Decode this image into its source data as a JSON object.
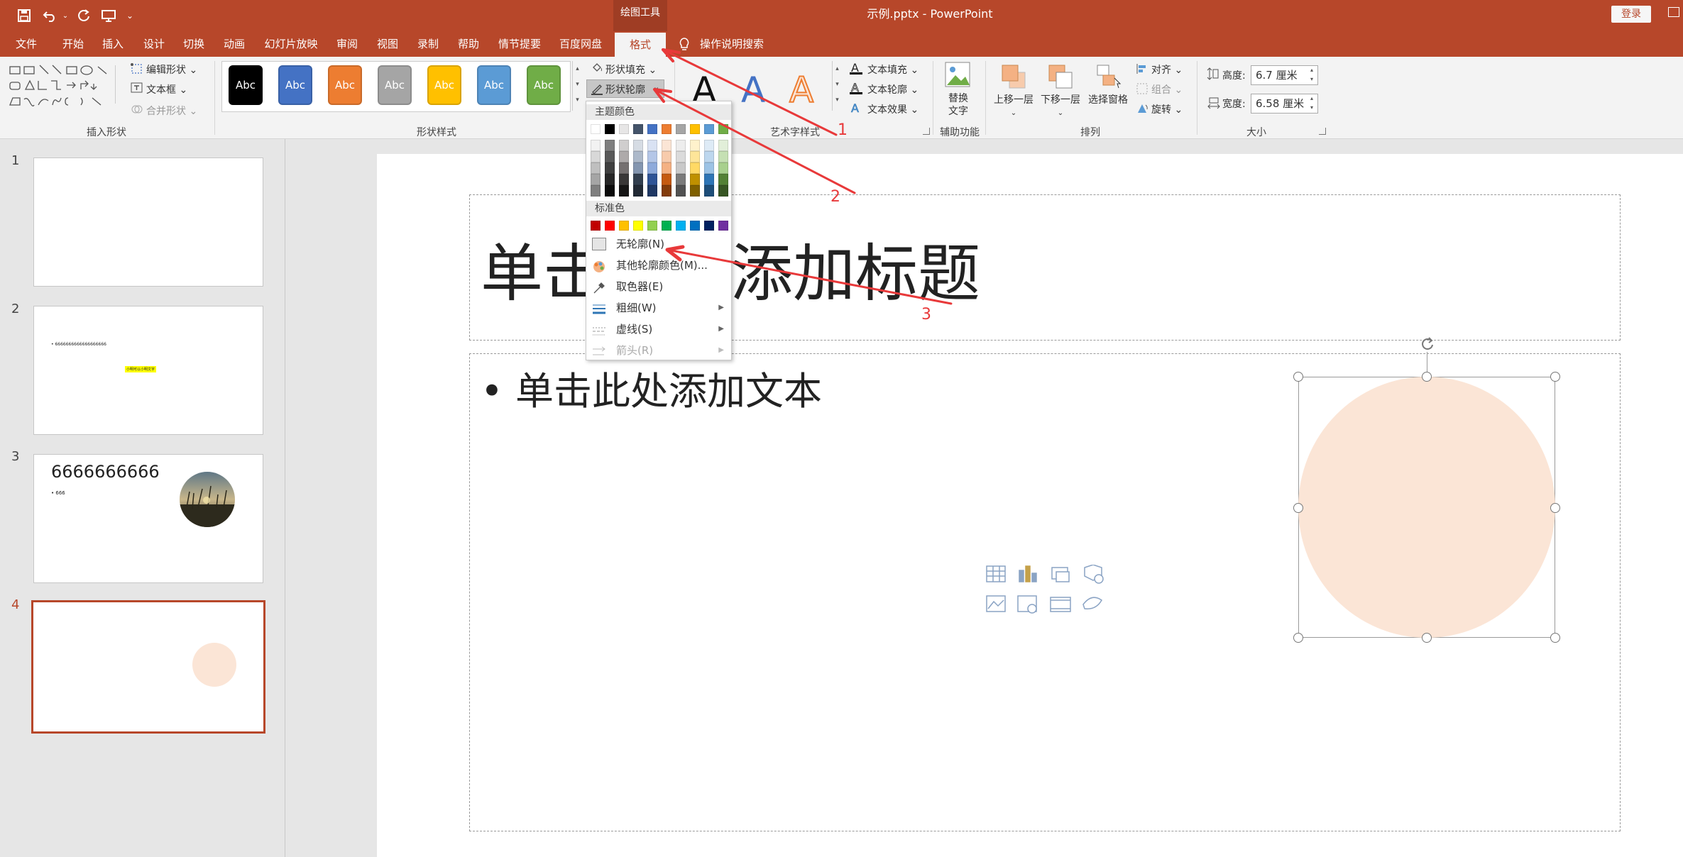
{
  "window": {
    "title": "示例.pptx - PowerPoint",
    "drawing_tools_label": "绘图工具",
    "login_label": "登录",
    "accent_color": "#b7472a"
  },
  "quick_access": {
    "icons": [
      "save-icon",
      "undo-icon",
      "redo-icon",
      "start-slideshow-icon",
      "customize-qat-icon"
    ]
  },
  "ribbon_tabs": {
    "file": "文件",
    "home": "开始",
    "insert": "插入",
    "design": "设计",
    "transitions": "切换",
    "animations": "动画",
    "slideshow": "幻灯片放映",
    "review": "审阅",
    "view": "视图",
    "record": "录制",
    "help": "帮助",
    "storyboard": "情节提要",
    "baidu": "百度网盘",
    "format": "格式",
    "tell_me": "操作说明搜索"
  },
  "ribbon": {
    "insert_shapes": {
      "group_label": "插入形状",
      "edit_shape": "编辑形状",
      "text_box": "文本框",
      "merge_shapes": "合并形状"
    },
    "shape_styles": {
      "group_label": "形状样式",
      "preset_label": "Abc",
      "preset_colors": [
        "#000000",
        "#4472c4",
        "#ed7d31",
        "#a5a5a5",
        "#ffc000",
        "#5b9bd5",
        "#70ad47"
      ],
      "shape_fill": "形状填充",
      "shape_outline": "形状轮廓"
    },
    "wordart": {
      "group_label": "艺术字样式",
      "letter": "A",
      "text_fill": "文本填充",
      "text_outline": "文本轮廓",
      "text_effects": "文本效果"
    },
    "accessibility": {
      "group_label": "辅助功能",
      "alt_text_line1": "替换",
      "alt_text_line2": "文字"
    },
    "arrange": {
      "group_label": "排列",
      "bring_forward": "上移一层",
      "send_backward": "下移一层",
      "selection_pane": "选择窗格",
      "align": "对齐",
      "group": "组合",
      "rotate": "旋转"
    },
    "size": {
      "group_label": "大小",
      "height_label": "高度:",
      "height_value": "6.7 厘米",
      "width_label": "宽度:",
      "width_value": "6.58 厘米"
    }
  },
  "outline_menu": {
    "theme_colors_header": "主题颜色",
    "theme_colors_top": [
      "#ffffff",
      "#000000",
      "#e7e6e6",
      "#44546a",
      "#4472c4",
      "#ed7d31",
      "#a5a5a5",
      "#ffc000",
      "#5b9bd5",
      "#70ad47"
    ],
    "theme_shades": [
      [
        "#f2f2f2",
        "#7f7f7f",
        "#d0cece",
        "#d6dce4",
        "#d9e2f3",
        "#fbe5d5",
        "#ededed",
        "#fff2cc",
        "#deebf6",
        "#e2efd9"
      ],
      [
        "#d8d8d8",
        "#595959",
        "#aeaaaa",
        "#adb9ca",
        "#b4c6e7",
        "#f7cbac",
        "#dbdbdb",
        "#fee599",
        "#bdd7ee",
        "#c5e0b3"
      ],
      [
        "#bfbfbf",
        "#3f3f3f",
        "#757070",
        "#8496b0",
        "#8eaadb",
        "#f4b183",
        "#c9c9c9",
        "#ffd965",
        "#9cc3e5",
        "#a8d08d"
      ],
      [
        "#a5a5a5",
        "#262626",
        "#3a3838",
        "#323f4f",
        "#2f5496",
        "#c55a11",
        "#7b7b7b",
        "#bf9000",
        "#2e75b5",
        "#538135"
      ],
      [
        "#7f7f7f",
        "#0c0c0c",
        "#171616",
        "#222a35",
        "#1f3864",
        "#833c0b",
        "#525252",
        "#7f6000",
        "#1e4e79",
        "#375623"
      ]
    ],
    "standard_colors_header": "标准色",
    "standard_colors": [
      "#c00000",
      "#ff0000",
      "#ffc000",
      "#ffff00",
      "#92d050",
      "#00b050",
      "#00b0f0",
      "#0070c0",
      "#002060",
      "#7030a0"
    ],
    "no_outline": "无轮廓(N)",
    "more_colors": "其他轮廓颜色(M)...",
    "eyedropper": "取色器(E)",
    "weight": "粗细(W)",
    "dashes": "虚线(S)",
    "arrows": "箭头(R)"
  },
  "annotations": {
    "labels": [
      "1",
      "2",
      "3"
    ],
    "color": "#e8393a"
  },
  "thumbnails": {
    "numbers": [
      "1",
      "2",
      "3",
      "4"
    ],
    "slide2_bullet": "6666666666666666666",
    "slide2_highlight": "小明可以小明文字",
    "slide3_title": "6666666666",
    "slide3_bullet": "666"
  },
  "slide": {
    "title_placeholder": "单击此处添加标题",
    "body_placeholder": "• 单击此处添加文本",
    "circle_fill": "#fbe5d6"
  }
}
